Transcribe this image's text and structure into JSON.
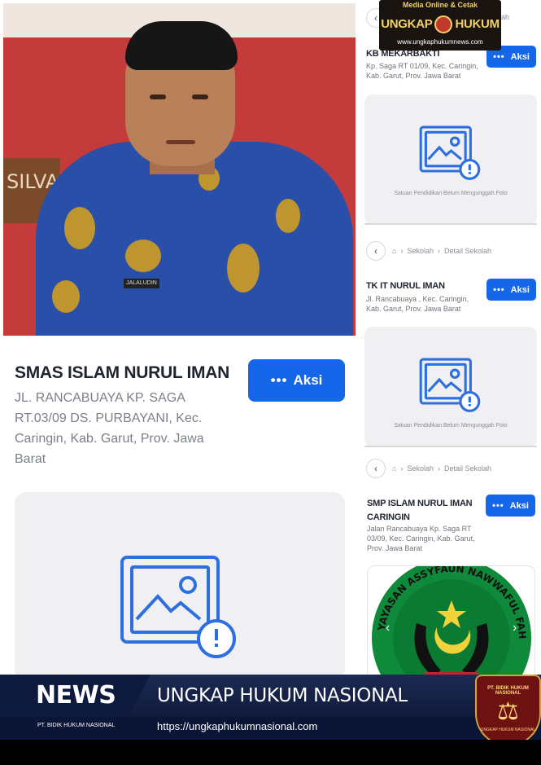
{
  "watermark": {
    "line1": "Media Online & Cetak",
    "brand_left": "UNGKAP",
    "brand_right": "HUKUM",
    "site": "www.ungkaphukumnews.com"
  },
  "photo": {
    "wall_text": "SILVA",
    "name_tag": "JALALUDIN"
  },
  "main_school": {
    "name": "SMAS ISLAM NURUL IMAN",
    "address": "JL. RANCABUAYA KP. SAGA RT.03/09 DS. PURBAYANI, Kec. Caringin, Kab. Garut, Prov. Jawa Barat",
    "aksi_label": "Aksi",
    "aksi_dots": "•••"
  },
  "right_column": {
    "top_crumb_partial": "ah",
    "schools": [
      {
        "name": "KB MEKARBAKTI",
        "address": "Kp. Saga RT 01/09, Kec. Caringin, Kab. Garut, Prov. Jawa Barat",
        "aksi_label": "Aksi"
      },
      {
        "name": "TK IT NURUL IMAN",
        "address": "Jl. Rancabuaya , Kec. Caringin, Kab. Garut, Prov. Jawa Barat",
        "aksi_label": "Aksi"
      },
      {
        "name": "SMP ISLAM NURUL IMAN CARINGIN",
        "address": "Jalan Rancabuaya Kp. Saga RT 03/09, Kec. Caringin, Kab. Garut, Prov. Jawa Barat",
        "aksi_label": "Aksi"
      }
    ],
    "no_photo_label": "Satuan Pendidikan Belum Mengunggah Foto",
    "breadcrumb": {
      "item1": "Sekolah",
      "item2": "Detail Sekolah"
    },
    "logo_text": "YAYASAN ASSYFAUN NAWWAFUL FAHMI"
  },
  "news_bar": {
    "label": "NEWS",
    "headline": "UNGKAP HUKUM NASIONAL",
    "company": "PT. BIDIK HUKUM NASIONAL",
    "url": "https://ungkaphukumnasional.com",
    "badge_top": "PT. BIDIK HUKUM NASIONAL",
    "badge_bottom": "UNGKAP HUKUM NASIONAL"
  },
  "colors": {
    "accent": "#1566e8",
    "icon_blue": "#2d6fe0",
    "news_bg": "#0d1a3e"
  }
}
